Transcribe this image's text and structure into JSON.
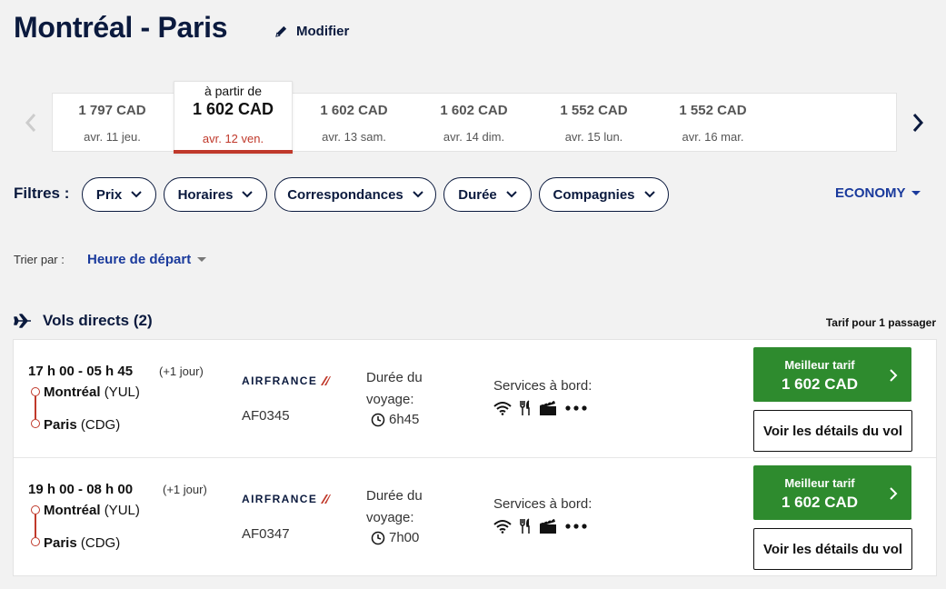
{
  "header": {
    "title": "Montréal - Paris",
    "modify_label": "Modifier"
  },
  "date_carousel": {
    "days": [
      {
        "price": "1 797 CAD",
        "date": "avr. 11 jeu."
      },
      {
        "price": "1 602 CAD",
        "date": "avr. 12 ven.",
        "from_label": "à partir de",
        "selected": true
      },
      {
        "price": "1 602 CAD",
        "date": "avr. 13 sam."
      },
      {
        "price": "1 602 CAD",
        "date": "avr. 14 dim."
      },
      {
        "price": "1 552 CAD",
        "date": "avr. 15 lun."
      },
      {
        "price": "1 552 CAD",
        "date": "avr. 16 mar."
      }
    ]
  },
  "filters": {
    "label": "Filtres :",
    "pills": [
      "Prix",
      "Horaires",
      "Correspondances",
      "Durée",
      "Compagnies"
    ],
    "cabin": "ECONOMY"
  },
  "sort": {
    "label": "Trier par :",
    "value": "Heure de départ"
  },
  "section": {
    "title": "Vols directs (2)",
    "tarif_note": "Tarif pour 1 passager"
  },
  "flights": [
    {
      "times": "17 h 00 - 05 h 45",
      "day_note": "(+1 jour)",
      "origin_city": "Montréal",
      "origin_code": "(YUL)",
      "dest_city": "Paris",
      "dest_code": "(CDG)",
      "airline": "AIRFRANCE",
      "flight_number": "AF0345",
      "duration_label": "Durée du voyage:",
      "duration": "6h45",
      "services_label": "Services à bord:",
      "services": [
        "wifi-icon",
        "meal-icon",
        "entertainment-icon",
        "more-icon"
      ],
      "best_label": "Meilleur tarif",
      "best_price": "1 602 CAD",
      "details_label": "Voir les détails du vol"
    },
    {
      "times": "19 h 00 - 08 h 00",
      "day_note": "(+1 jour)",
      "origin_city": "Montréal",
      "origin_code": "(YUL)",
      "dest_city": "Paris",
      "dest_code": "(CDG)",
      "airline": "AIRFRANCE",
      "flight_number": "AF0347",
      "duration_label": "Durée du voyage:",
      "duration": "7h00",
      "services_label": "Services à bord:",
      "services": [
        "wifi-icon",
        "meal-icon",
        "entertainment-icon",
        "more-icon"
      ],
      "best_label": "Meilleur tarif",
      "best_price": "1 602 CAD",
      "details_label": "Voir les détails du vol"
    }
  ],
  "colors": {
    "navy": "#0b1a3e",
    "accent_red": "#c0392b",
    "link_blue": "#1a3a9c",
    "green": "#2e8b2e"
  }
}
